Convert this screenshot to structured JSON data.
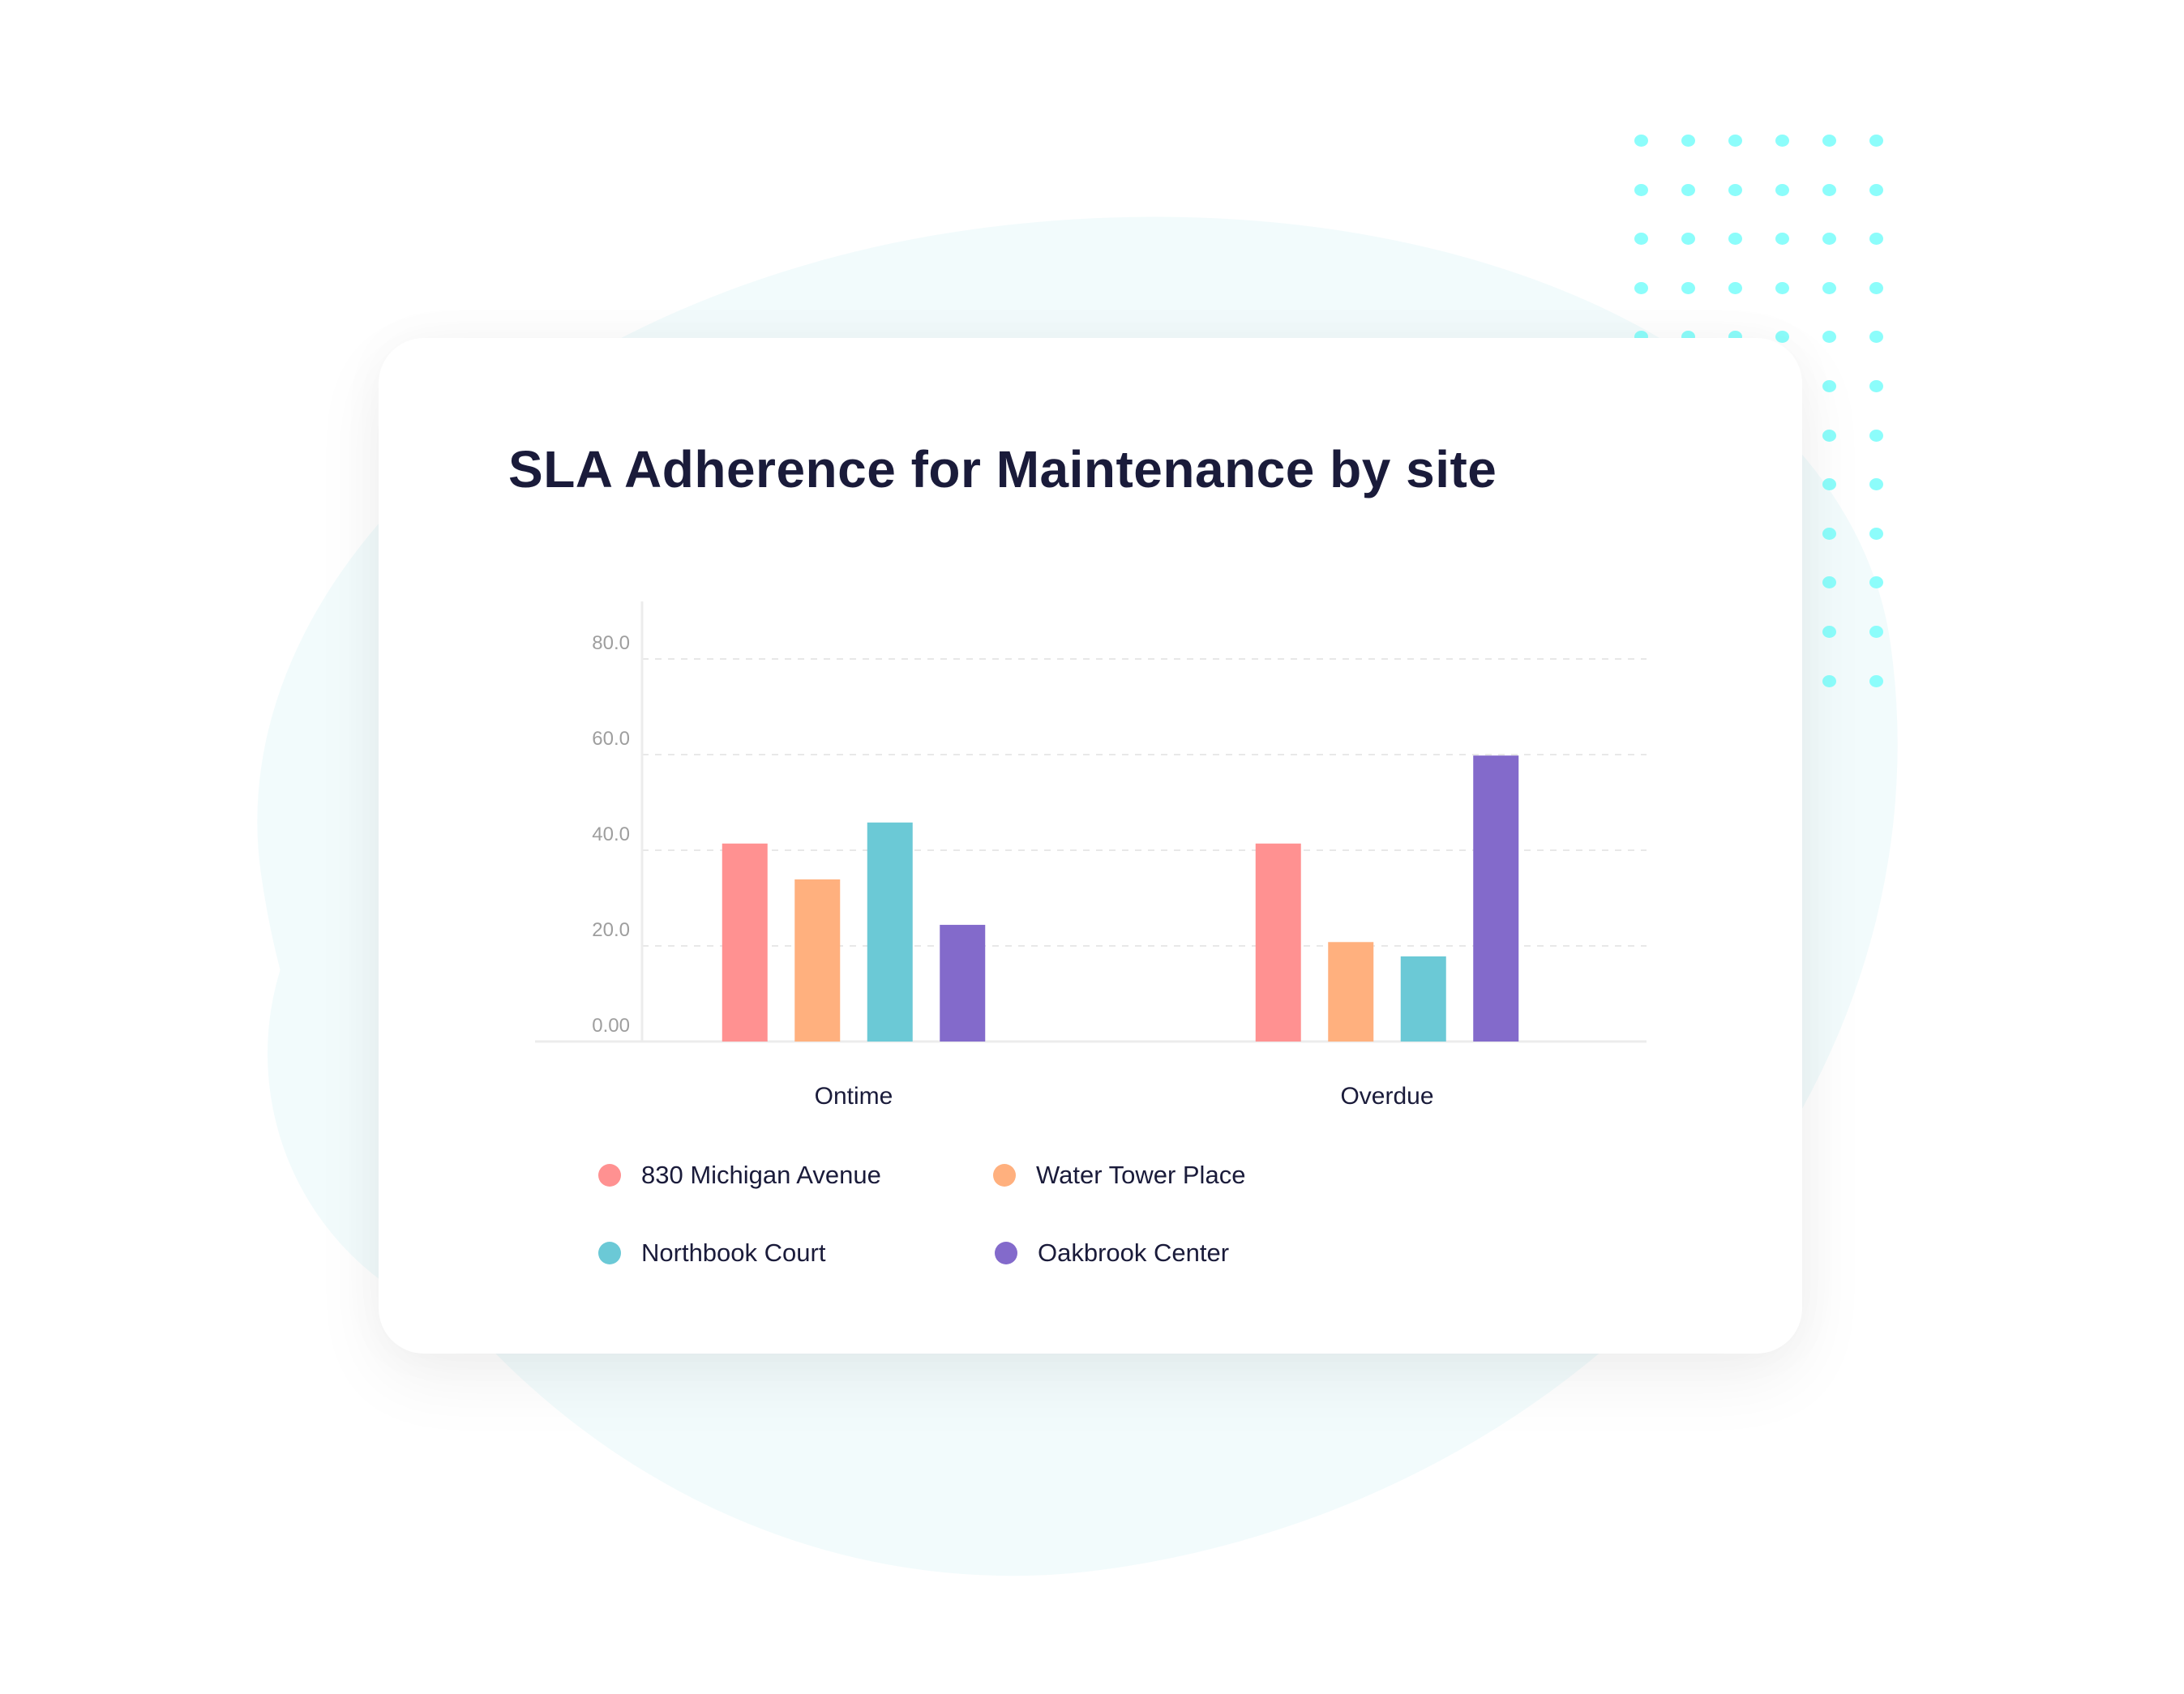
{
  "chart_data": {
    "type": "bar",
    "title": "SLA Adherence for Maintenance by site",
    "xlabel": "",
    "ylabel": "",
    "categories": [
      "Ontime",
      "Overdue"
    ],
    "series": [
      {
        "name": "830 Michigan Avenue",
        "color": "#ff9191",
        "values": [
          41.4,
          41.4
        ]
      },
      {
        "name": "Water Tower Place",
        "color": "#ffb07e",
        "values": [
          33.9,
          20.8
        ]
      },
      {
        "name": "Northbook Court",
        "color": "#6bc9d6",
        "values": [
          45.8,
          17.8
        ]
      },
      {
        "name": "Oakbrook Center",
        "color": "#836acb",
        "values": [
          24.4,
          59.8
        ]
      }
    ],
    "ylim": [
      0,
      80
    ],
    "yticks": [
      0,
      20,
      40,
      60,
      80
    ],
    "ytick_labels": [
      "0.00",
      "20.0",
      "40.0",
      "60.0",
      "80.0"
    ],
    "grid": true,
    "legend_position": "bottom"
  },
  "colors": {
    "title_text": "#1a1b3a",
    "tick_text": "#9e9e9e",
    "dot_pattern": "#8cfdfb",
    "background_blob": "#f2fbfc"
  }
}
